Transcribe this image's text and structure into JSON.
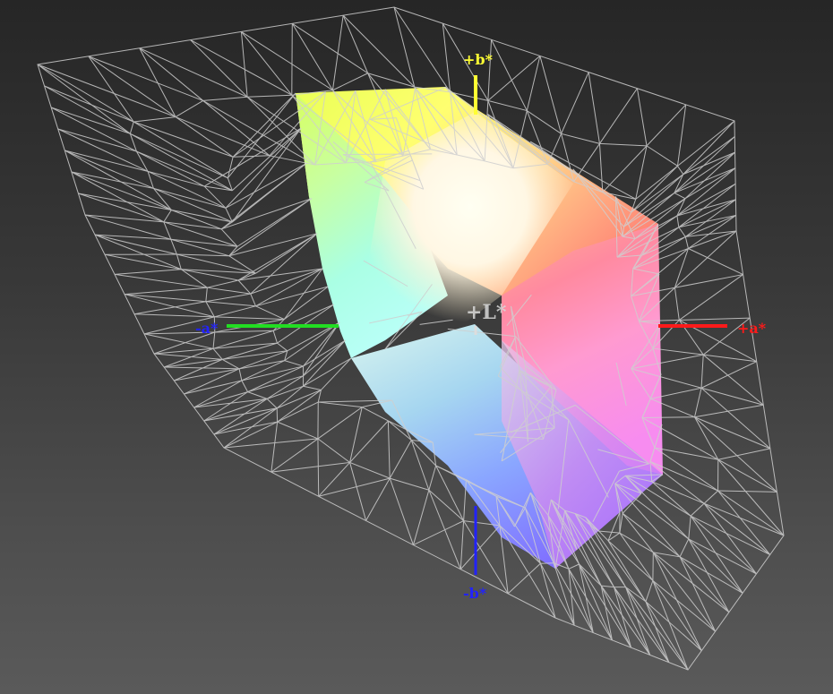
{
  "axes": {
    "plus_b": {
      "label": "+b*",
      "color": "#ffff33"
    },
    "minus_b": {
      "label": "-b*",
      "color": "#2222ff"
    },
    "plus_a": {
      "label": "+a*",
      "color": "#ff1a1a"
    },
    "minus_a": {
      "label": "-a*",
      "color": "#22dd22"
    },
    "plus_l": {
      "label": "+L*",
      "color": "#d8d8d8"
    }
  },
  "colors": {
    "background_top": "#262626",
    "background_bottom": "#5a5a5a",
    "wireframe": "#cfcfcf"
  },
  "legend": {}
}
